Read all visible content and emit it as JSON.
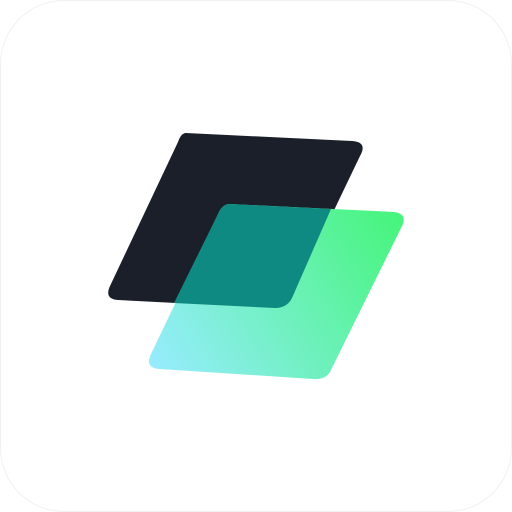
{
  "app_icon": {
    "icon": "layered-parallelograms-logo",
    "colors": {
      "background": "#ffffff",
      "back_layer": "#1b1f2a",
      "front_gradient_start": "#97ecff",
      "front_gradient_end": "#45f57a",
      "overlap": "#0e8a82"
    }
  }
}
